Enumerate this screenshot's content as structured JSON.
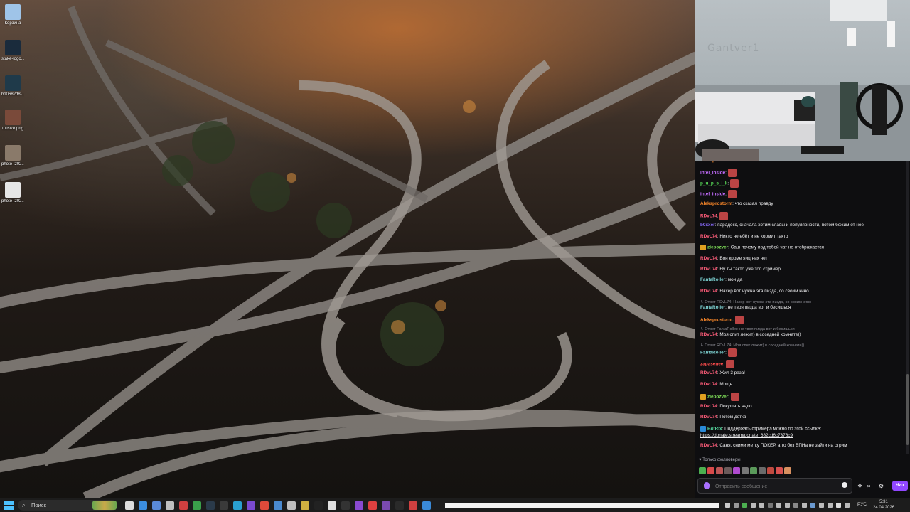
{
  "desktop": {
    "icons": [
      {
        "label": "Корзина",
        "icon": "recycle-bin-icon",
        "color": "#9fc4e8"
      },
      {
        "label": "stake-logo...",
        "icon": "stake-logo-icon",
        "color": "#1a2b3c"
      },
      {
        "label": "b10682d8-...",
        "icon": "image-file-icon",
        "color": "#1f3a4a"
      },
      {
        "label": "fullsize.png",
        "icon": "image-file-icon",
        "color": "#7a4a3a"
      },
      {
        "label": "photo_202...",
        "icon": "photo-file-icon",
        "color": "#8a7a6a"
      },
      {
        "label": "photo_202...",
        "icon": "photo-file-icon",
        "color": "#e6e6e6"
      }
    ]
  },
  "webcam": {
    "wall_text": "Gantver1"
  },
  "chat": {
    "messages": [
      {
        "user": "Aleksprostorm",
        "text": "",
        "color": "#ff8a2a",
        "partial": true,
        "emote": false
      },
      {
        "user": "intel_inside",
        "text": "",
        "color": "#c46cff",
        "emote": true
      },
      {
        "user": "p_u_p_s_i_k",
        "text": "",
        "color": "#57d957",
        "emote": true
      },
      {
        "user": "intel_inside",
        "text": "",
        "color": "#c46cff",
        "emote": true
      },
      {
        "user": "Aleksprostorm",
        "text": "что сказал правду",
        "color": "#ff8a2a",
        "emote": false
      },
      {
        "user": "RDvL74",
        "text": "",
        "color": "#ff5d7a",
        "emote": true
      },
      {
        "user": "b0xxer",
        "text": "парадокс, сначала хотим славы и популярности, потом бежим от нее",
        "color": "#8a6cff",
        "emote": false
      },
      {
        "user": "RDvL74",
        "text": "Никто не ебёт и не кормит такто",
        "color": "#ff5d7a",
        "emote": false
      },
      {
        "user": "ziepozver",
        "text": "Саш почему под тобой чат не отображается",
        "color": "#7cd957",
        "emote": false,
        "badge": "#e0a020"
      },
      {
        "user": "RDvL74",
        "text": "Вон кроме яиц них нет",
        "color": "#ff5d7a",
        "emote": false
      },
      {
        "user": "RDvL74",
        "text": "Ну ты такто уже топ стример",
        "color": "#ff5d7a",
        "emote": false
      },
      {
        "user": "FantaRoller",
        "text": "мои да",
        "color": "#7fd6d6",
        "emote": false
      },
      {
        "user": "RDvL74",
        "text": "Нахер вот нужна эта пизда, со своим кино",
        "color": "#ff5d7a",
        "emote": false
      },
      {
        "reply": "Ответ RDvL74: Нахер вот нужна эта пизда, со своим кино"
      },
      {
        "user": "FantaRoller",
        "text": "не твоя пизда вот и бесишься",
        "color": "#7fd6d6",
        "emote": false
      },
      {
        "user": "Aleksprostorm",
        "text": "",
        "color": "#ff8a2a",
        "emote": true
      },
      {
        "reply": "Ответ FantaRoller: не твоя пизда вот и бесишься"
      },
      {
        "user": "RDvL74",
        "text": "Моя спит лежит) в соседней комнате))",
        "color": "#ff5d7a",
        "emote": false
      },
      {
        "reply": "Ответ RDvL74: Моя спит лежит) в соседней комнате))"
      },
      {
        "user": "FantaRoller",
        "text": "",
        "color": "#7fd6d6",
        "emote": true
      },
      {
        "user": "zapasenee",
        "text": "",
        "color": "#ff4d4d",
        "emote": true
      },
      {
        "user": "RDvL74",
        "text": "Жил 3 раза!",
        "color": "#ff5d7a",
        "emote": false
      },
      {
        "user": "RDvL74",
        "text": "Мощь",
        "color": "#ff5d7a",
        "emote": false
      },
      {
        "user": "ziepozver",
        "text": "",
        "color": "#7cd957",
        "emote": true,
        "badge": "#e0a020"
      },
      {
        "user": "RDvL74",
        "text": "Покушать надо",
        "color": "#ff5d7a",
        "emote": false
      },
      {
        "user": "RDvL74",
        "text": "Потом дотка",
        "color": "#ff5d7a",
        "emote": false
      },
      {
        "user": "BotRix",
        "text": "Поддержать стримера можно по этой ссылке:",
        "color": "#57d9a0",
        "emote": false,
        "badge": "#2a8ad8"
      },
      {
        "link": "https://donate.stream/donate_682cd6c7376c9"
      },
      {
        "user": "RDvL74",
        "text": "Саня, сними метку ПОКЕР, а то без ВПНа не зайти на стрим",
        "color": "#ff5d7a",
        "emote": false
      }
    ],
    "followers_only": "Только фолловеры",
    "input_placeholder": "Отправить сообщение",
    "send_label": "Чат"
  },
  "taskbar": {
    "search_placeholder": "Поиск",
    "lang": "РУС",
    "time": "5:31",
    "date": "24.04.2026",
    "apps": [
      {
        "icon": "task-view-icon",
        "color": "#dddddd"
      },
      {
        "icon": "app-blue-icon",
        "color": "#3b8ee0"
      },
      {
        "icon": "app-tablet-icon",
        "color": "#5a8ad8"
      },
      {
        "icon": "app-pen-icon",
        "color": "#c0c0c0"
      },
      {
        "icon": "app-64-icon",
        "color": "#d04040"
      },
      {
        "icon": "app-green-icon",
        "color": "#3aa04a"
      },
      {
        "icon": "app-steam-icon",
        "color": "#2a3a4a"
      },
      {
        "icon": "app-dark-icon",
        "color": "#3a3a3a"
      },
      {
        "icon": "edge-icon",
        "color": "#2aa0d0"
      },
      {
        "icon": "app-purple-icon",
        "color": "#7a4ad0"
      },
      {
        "icon": "chrome-icon",
        "color": "#e04a3a"
      },
      {
        "icon": "app-mail-icon",
        "color": "#4a8ad0"
      },
      {
        "icon": "app-grid-icon",
        "color": "#c0c0c0"
      },
      {
        "icon": "app-yellow-icon",
        "color": "#d0b040"
      },
      {
        "icon": "app-black-icon",
        "color": "#222222"
      },
      {
        "icon": "app-v2-icon",
        "color": "#e0e0e0"
      },
      {
        "icon": "app-terminal-icon",
        "color": "#333333"
      },
      {
        "icon": "app-purple2-icon",
        "color": "#8a4ad0"
      },
      {
        "icon": "yandex-icon",
        "color": "#e04040"
      },
      {
        "icon": "app-purple3-icon",
        "color": "#7a4ab0"
      },
      {
        "icon": "app-h-icon",
        "color": "#2a2a2a"
      },
      {
        "icon": "app-red-icon",
        "color": "#d04040"
      },
      {
        "icon": "app-blue2-icon",
        "color": "#3a8ad8"
      }
    ]
  }
}
